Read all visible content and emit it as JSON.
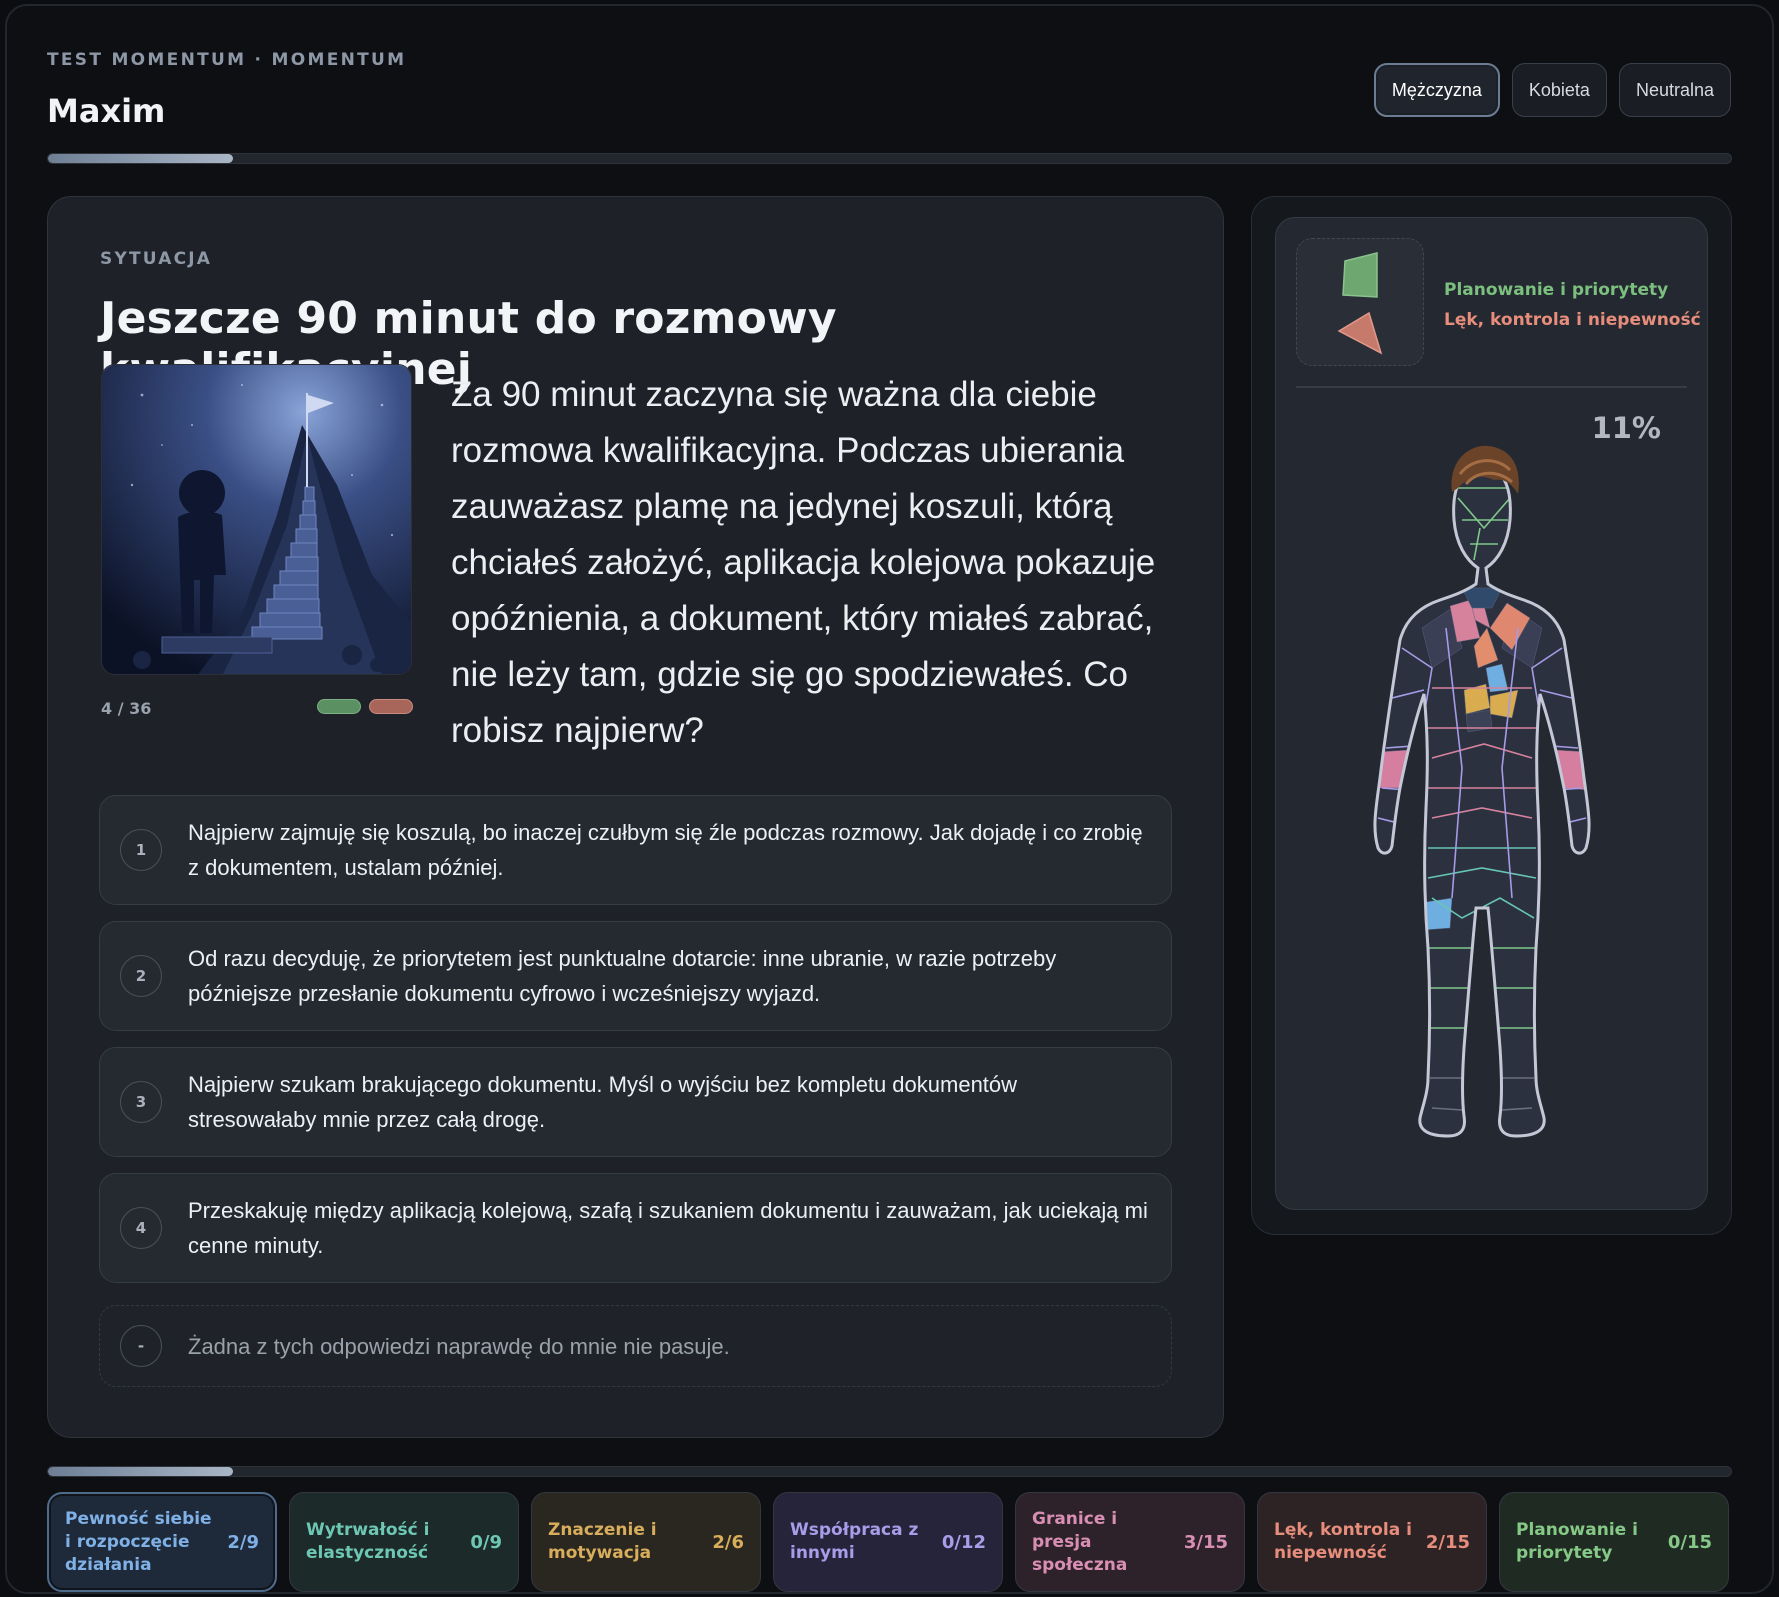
{
  "header": {
    "kicker": "TEST MOMENTUM · MOMENTUM",
    "user_name": "Maxim",
    "gender_options": [
      "Mężczyzna",
      "Kobieta",
      "Neutralna"
    ],
    "gender_selected": "Mężczyzna",
    "progress_fraction": 0.11
  },
  "situation": {
    "kicker": "SYTUACJA",
    "title": "Jeszcze 90 minut do rozmowy kwalifikacyjnej",
    "counter": "4 / 36",
    "question": "Za 90 minut zaczyna się ważna dla ciebie rozmowa kwalifikacyjna. Podczas ubierania zauważasz plamę na jedynej koszuli, którą chciałeś założyć, aplikacja kolejowa pokazuje opóźnienia, a dokument, który miałeś zabrać, nie leży tam, gdzie się go spodziewałeś. Co robisz najpierw?",
    "options": [
      {
        "num": "1",
        "text": "Najpierw zajmuję się koszulą, bo inaczej czułbym się źle podczas rozmowy. Jak dojadę i co zrobię z dokumentem, ustalam później."
      },
      {
        "num": "2",
        "text": "Od razu decyduję, że priorytetem jest punktualne dotarcie: inne ubranie, w razie potrzeby późniejsze przesłanie dokumentu cyfrowo i wcześniejszy wyjazd."
      },
      {
        "num": "3",
        "text": "Najpierw szukam brakującego dokumentu. Myśl o wyjściu bez kompletu dokumentów stresowałaby mnie przez całą drogę."
      },
      {
        "num": "4",
        "text": "Przeskakuję między aplikacją kolejową, szafą i szukaniem dokumentu i zauważam, jak uciekają mi cenne minuty."
      }
    ],
    "none_option": {
      "num": "-",
      "text": "Żadna z tych odpowiedzi naprawdę do mnie nie pasuje."
    }
  },
  "side_panel": {
    "legend": [
      {
        "label": "Planowanie i priorytety",
        "color": "#7cc07f"
      },
      {
        "label": "Lęk, kontrola i niepewność",
        "color": "#e78d7b"
      }
    ],
    "percent": "11%"
  },
  "categories": [
    {
      "label": "Pewność siebie i rozpoczęcie działania",
      "value": "2/9",
      "color": "#7fb0e6",
      "bg": "#1e2a3a",
      "active": true
    },
    {
      "label": "Wytrwałość i elastyczność",
      "value": "0/9",
      "color": "#6dc7b2",
      "bg": "#1c2a29"
    },
    {
      "label": "Znaczenie i motywacja",
      "value": "2/6",
      "color": "#d8ad5c",
      "bg": "#2a2720"
    },
    {
      "label": "Współpraca z innymi",
      "value": "0/12",
      "color": "#a99ce8",
      "bg": "#25243a"
    },
    {
      "label": "Granice i presja społeczna",
      "value": "3/15",
      "color": "#d98fb4",
      "bg": "#2d2229"
    },
    {
      "label": "Lęk, kontrola i niepewność",
      "value": "2/15",
      "color": "#e78d7b",
      "bg": "#2e2324"
    },
    {
      "label": "Planowanie i priorytety",
      "value": "0/15",
      "color": "#86c987",
      "bg": "#1f2b22"
    }
  ]
}
